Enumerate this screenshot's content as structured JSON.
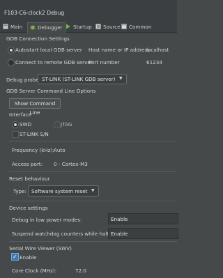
{
  "window": {
    "title": "F103-C6-clock2 Debug"
  },
  "tabs": [
    {
      "label": "Main",
      "icon": "main-icon"
    },
    {
      "label": "Debugger",
      "icon": "debugger-icon"
    },
    {
      "label": "Startup",
      "icon": "startup-icon"
    },
    {
      "label": "Source",
      "icon": "source-icon"
    },
    {
      "label": "Common",
      "icon": "common-icon"
    }
  ],
  "gdb_connection": {
    "section_title": "GDB Connection Settings",
    "autostart_label": "Autostart local GDB server",
    "remote_label": "Connect to remote GDB server",
    "host_label": "Host name or IP address",
    "host_value": "localhost",
    "port_label": "Port number",
    "port_value": "61234"
  },
  "debug_probe": {
    "label": "Debug probe",
    "value": "ST-LINK (ST-LINK GDB server)"
  },
  "gdb_server_cmd": {
    "section_title": "GDB Server Command Line Options",
    "show_button": "Show Command Line"
  },
  "interface": {
    "title": "Interface",
    "swd_label": "SWD",
    "jtag_label": "JTAG",
    "stlink_sn_label": "ST-LINK S/N",
    "frequency_label": "Frequency (kHz):",
    "frequency_value": "Auto",
    "access_port_label": "Access port:",
    "access_port_value": "0 - Cortex-M3"
  },
  "reset": {
    "title": "Reset behaviour",
    "type_label": "Type:",
    "type_value": "Software system reset"
  },
  "device": {
    "title": "Device settings",
    "low_power_label": "Debug in low power modes:",
    "low_power_value": "Enable",
    "watchdog_label": "Suspend watchdog counters while halted:",
    "watchdog_value": "Enable"
  },
  "swv": {
    "title": "Serial Wire Viewer (SWV)",
    "enable_label": "Enable",
    "core_clock_label": "Core Clock (MHz):",
    "core_clock_value": "72.0"
  },
  "colors": {
    "background": "#45494a",
    "accent": "#3b7ab8"
  }
}
